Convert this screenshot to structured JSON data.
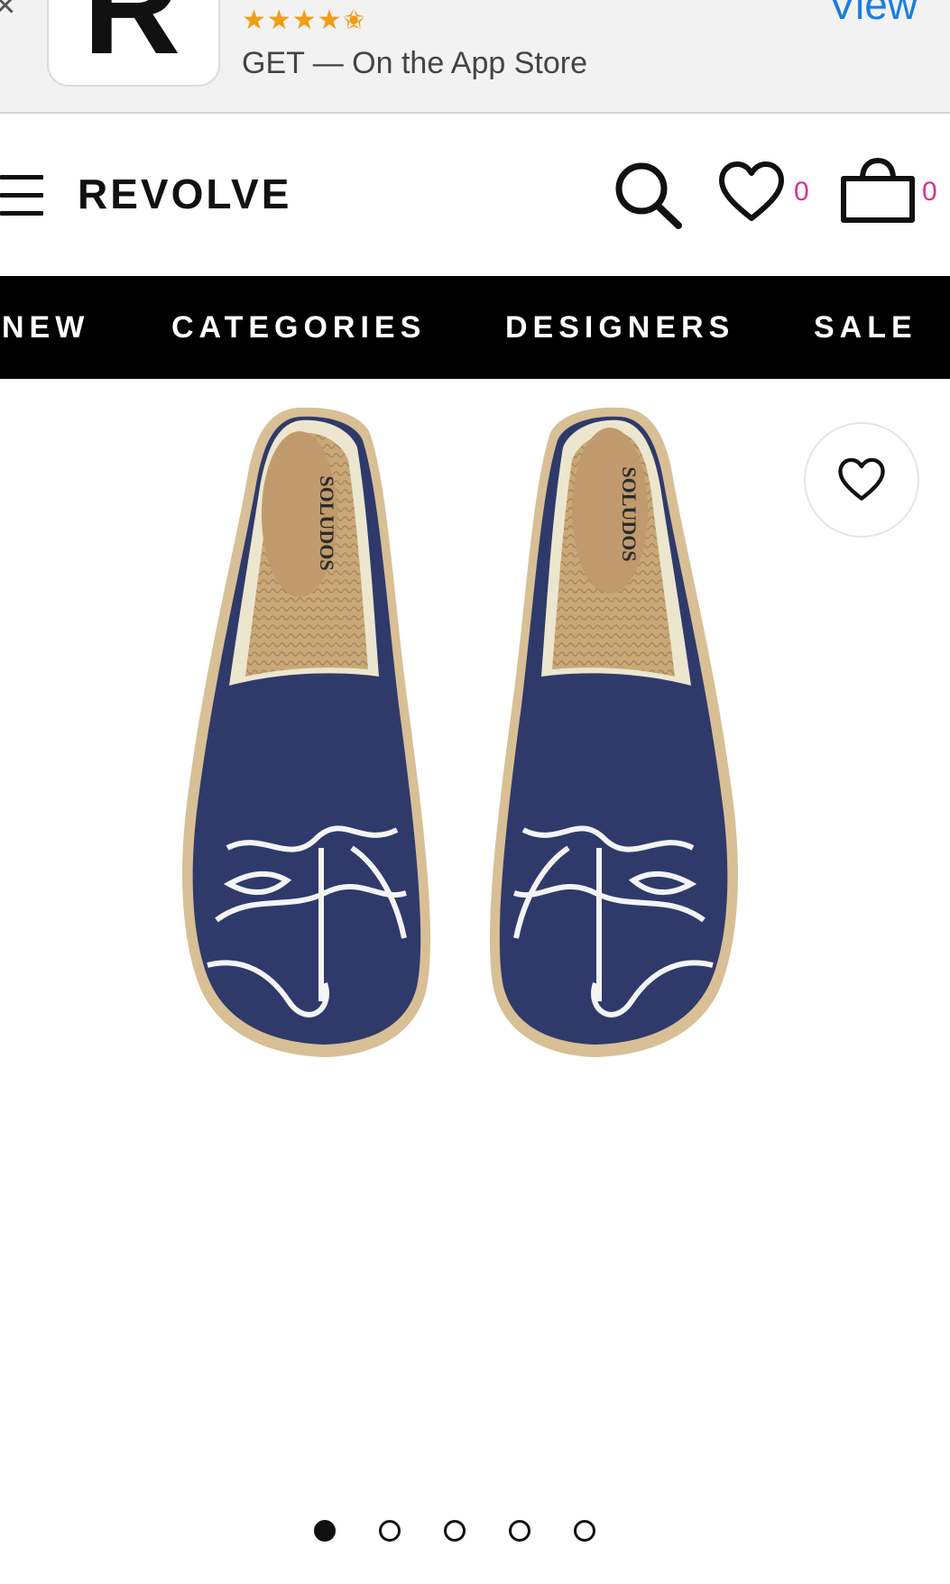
{
  "app_banner": {
    "close_glyph": "×",
    "icon_letter": "R",
    "rating_stars": "★★★★✬",
    "cta": "GET — On the App Store",
    "view_label": "View"
  },
  "header": {
    "brand": "REVOLVE",
    "wishlist_count": "0",
    "cart_count": "0"
  },
  "nav": {
    "items": [
      {
        "label": "NEW"
      },
      {
        "label": "CATEGORIES"
      },
      {
        "label": "DESIGNERS"
      },
      {
        "label": "SALE"
      }
    ]
  },
  "product": {
    "image_icon": "espadrille-shoes-image",
    "insole_text": "SOLUDOS",
    "carousel": {
      "total": 5,
      "active_index": 0
    }
  },
  "colors": {
    "accent_count": "#d6338f",
    "banner_link": "#1a7de0",
    "star": "#f39c12",
    "nav_bg": "#000000",
    "shoe_navy": "#2f3a6b"
  },
  "icons": {
    "menu": "hamburger-icon",
    "search": "search-icon",
    "wishlist": "heart-icon",
    "cart": "shopping-bag-icon",
    "favorite": "heart-icon"
  }
}
